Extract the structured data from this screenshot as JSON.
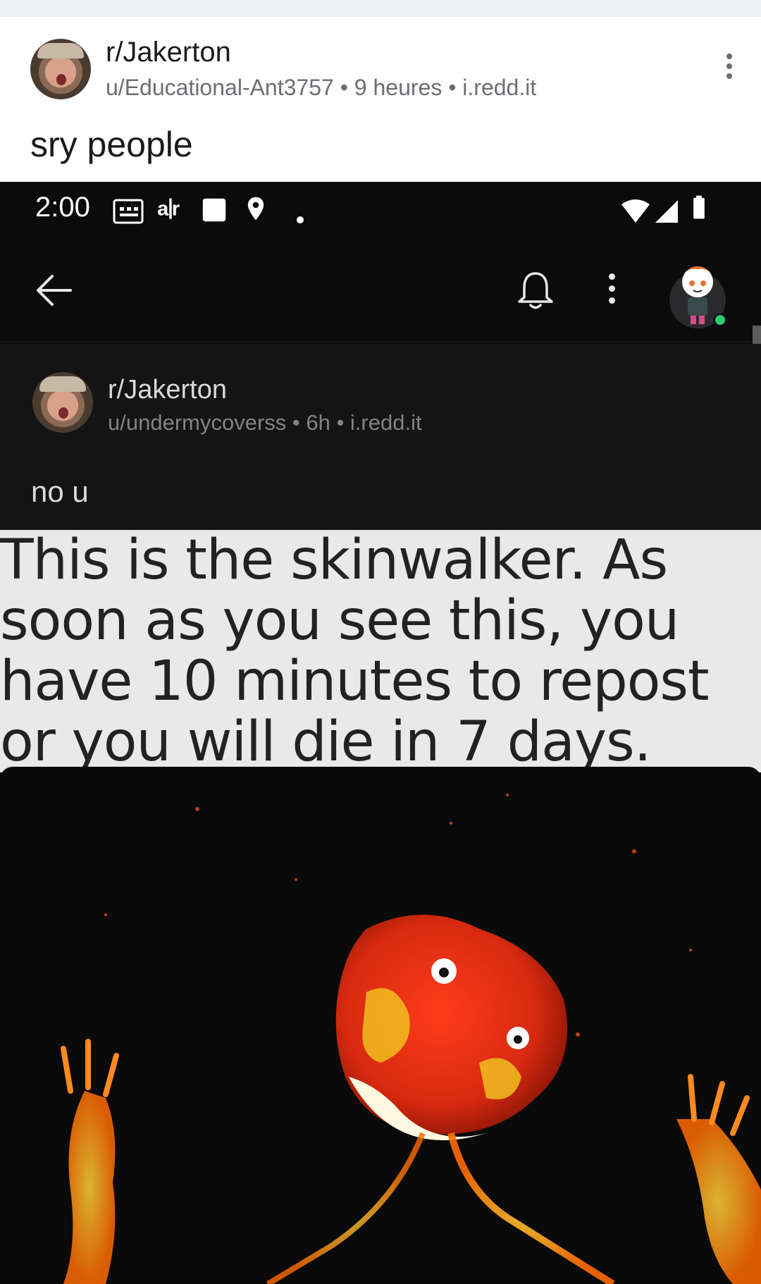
{
  "outer_post": {
    "subreddit": "r/Jakerton",
    "meta": "u/Educational-Ant3757 • 9 heures • i.redd.it",
    "title": "sry people"
  },
  "status_bar": {
    "time": "2:00"
  },
  "inner_post": {
    "subreddit": "r/Jakerton",
    "meta": "u/undermycoverss • 6h • i.redd.it",
    "title": "no u"
  },
  "meme": {
    "caption_lines": [
      "This is the skinwalker. As",
      "soon as you see this, you",
      "have 10 minutes to repost",
      "or you will die in 7 days."
    ]
  },
  "colors": {
    "background_light": "#ffffff",
    "background_dark": "#0b0b0c",
    "meta_text": "#6b6e72",
    "online_dot": "#2ecc71"
  },
  "icons": [
    "more-vert-icon",
    "back-arrow-icon",
    "bell-icon",
    "wifi-icon",
    "signal-icon",
    "battery-icon",
    "location-icon"
  ]
}
